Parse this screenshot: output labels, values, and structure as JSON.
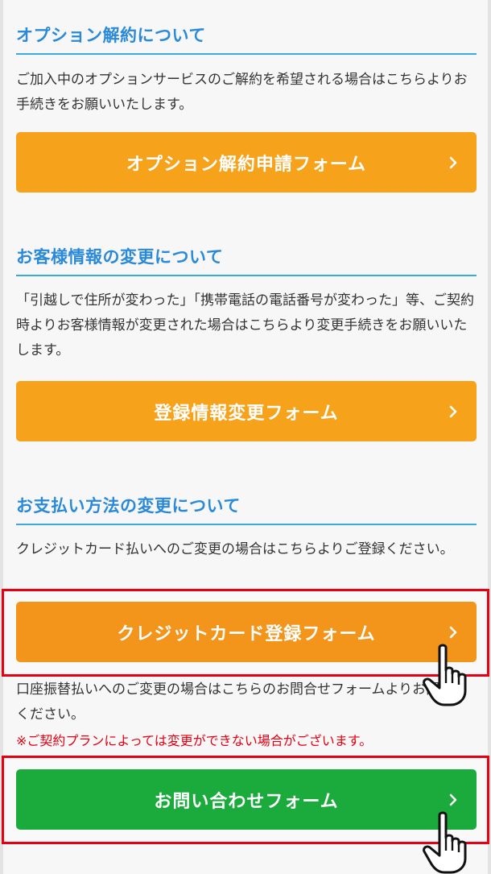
{
  "sections": {
    "option": {
      "heading": "オプション解約について",
      "text": "ご加入中のオプションサービスのご解約を希望される場合はこちらよりお手続きをお願いいたします。",
      "button": "オプション解約申請フォーム"
    },
    "customer": {
      "heading": "お客様情報の変更について",
      "text": "「引越しで住所が変わった」「携帯電話の電話番号が変わった」等、ご契約時よりお客様情報が変更された場合はこちらより変更手続きをお願いいたします。",
      "button": "登録情報変更フォーム"
    },
    "payment": {
      "heading": "お支払い方法の変更について",
      "text": "クレジットカード払いへのご変更の場合はこちらよりご登録ください。",
      "credit_button": "クレジットカード登録フォーム",
      "bank_text": "口座振替払いへのご変更の場合はこちらのお問合せフォームよりお問合せください。",
      "note": "※ご契約プランによっては変更ができない場合がございます。",
      "contact_button": "お問い合わせフォーム"
    }
  },
  "colors": {
    "heading": "#2a8ad8",
    "orange": "#f6a21b",
    "green": "#1aab3c",
    "highlight": "#e60012"
  },
  "icons": {
    "chevron": "chevron-right-icon",
    "cursor": "hand-pointer-icon"
  }
}
